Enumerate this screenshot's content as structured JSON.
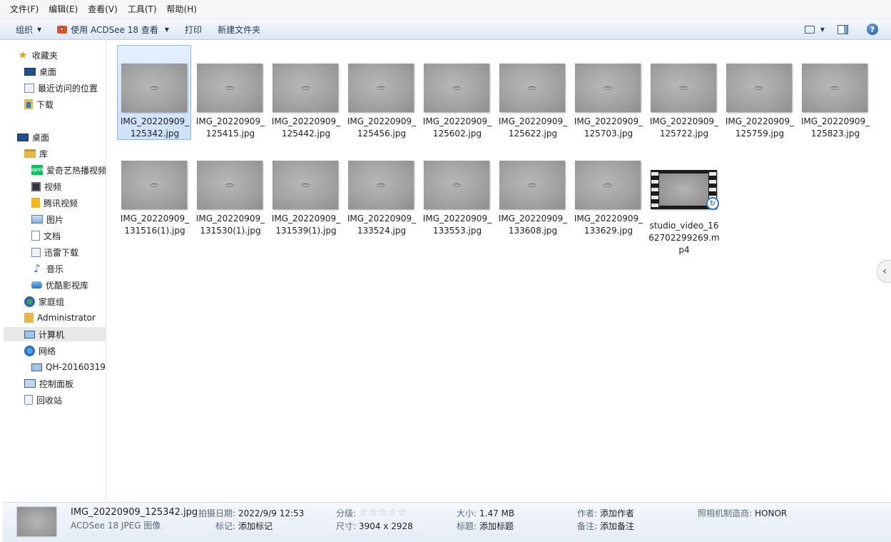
{
  "menu": [
    "文件(F)",
    "编辑(E)",
    "查看(V)",
    "工具(T)",
    "帮助(H)"
  ],
  "toolbar": {
    "organize": "组织",
    "open_with": "使用 ACDSee 18 查看",
    "print": "打印",
    "new_folder": "新建文件夹"
  },
  "nav": {
    "favorites": "收藏夹",
    "desktop_fav": "桌面",
    "recent": "最近访问的位置",
    "downloads": "下载",
    "desktop": "桌面",
    "library": "库",
    "iqiyi": "爱奇艺热播视频",
    "videos": "视频",
    "tencent": "腾讯视频",
    "pictures": "图片",
    "documents": "文档",
    "xunlei": "迅雷下载",
    "music": "音乐",
    "youku": "优酷影视库",
    "homegroup": "家庭组",
    "admin": "Administrator",
    "computer": "计算机",
    "network": "网络",
    "network_pc": "QH-20160319",
    "control_panel": "控制面板",
    "recycle_bin": "回收站"
  },
  "files": [
    {
      "name": "IMG_20220909_\n125342.jpg"
    },
    {
      "name": "IMG_20220909_\n125415.jpg"
    },
    {
      "name": "IMG_20220909_\n125442.jpg"
    },
    {
      "name": "IMG_20220909_\n125456.jpg"
    },
    {
      "name": "IMG_20220909_\n125602.jpg"
    },
    {
      "name": "IMG_20220909_\n125622.jpg"
    },
    {
      "name": "IMG_20220909_\n125703.jpg"
    },
    {
      "name": "IMG_20220909_\n125722.jpg"
    },
    {
      "name": "IMG_20220909_\n125759.jpg"
    },
    {
      "name": "IMG_20220909_\n125823.jpg"
    },
    {
      "name": "IMG_20220909_\n131516(1).jpg"
    },
    {
      "name": "IMG_20220909_\n131530(1).jpg"
    },
    {
      "name": "IMG_20220909_\n131539(1).jpg"
    },
    {
      "name": "IMG_20220909_\n133524.jpg"
    },
    {
      "name": "IMG_20220909_\n133553.jpg"
    },
    {
      "name": "IMG_20220909_\n133608.jpg"
    },
    {
      "name": "IMG_20220909_\n133629.jpg"
    },
    {
      "name": "studio_video_16\n62702299269.m\np4"
    }
  ],
  "details": {
    "file_name": "IMG_20220909_125342.jpg",
    "file_type": "ACDSee 18 JPEG 图像",
    "date_taken_label": "拍摄日期:",
    "date_taken": "2022/9/9 12:53",
    "tags_label": "标记:",
    "tags": "添加标记",
    "rating_label": "分级:",
    "rating_stars": "☆☆☆☆☆",
    "dimensions_label": "尺寸:",
    "dimensions": "3904 x 2928",
    "size_label": "大小:",
    "size": "1.47 MB",
    "title_label": "标题:",
    "title": "添加标题",
    "author_label": "作者:",
    "author": "添加作者",
    "comments_label": "备注:",
    "comments": "添加备注",
    "maker_label": "照相机制造商:",
    "maker": "HONOR"
  }
}
